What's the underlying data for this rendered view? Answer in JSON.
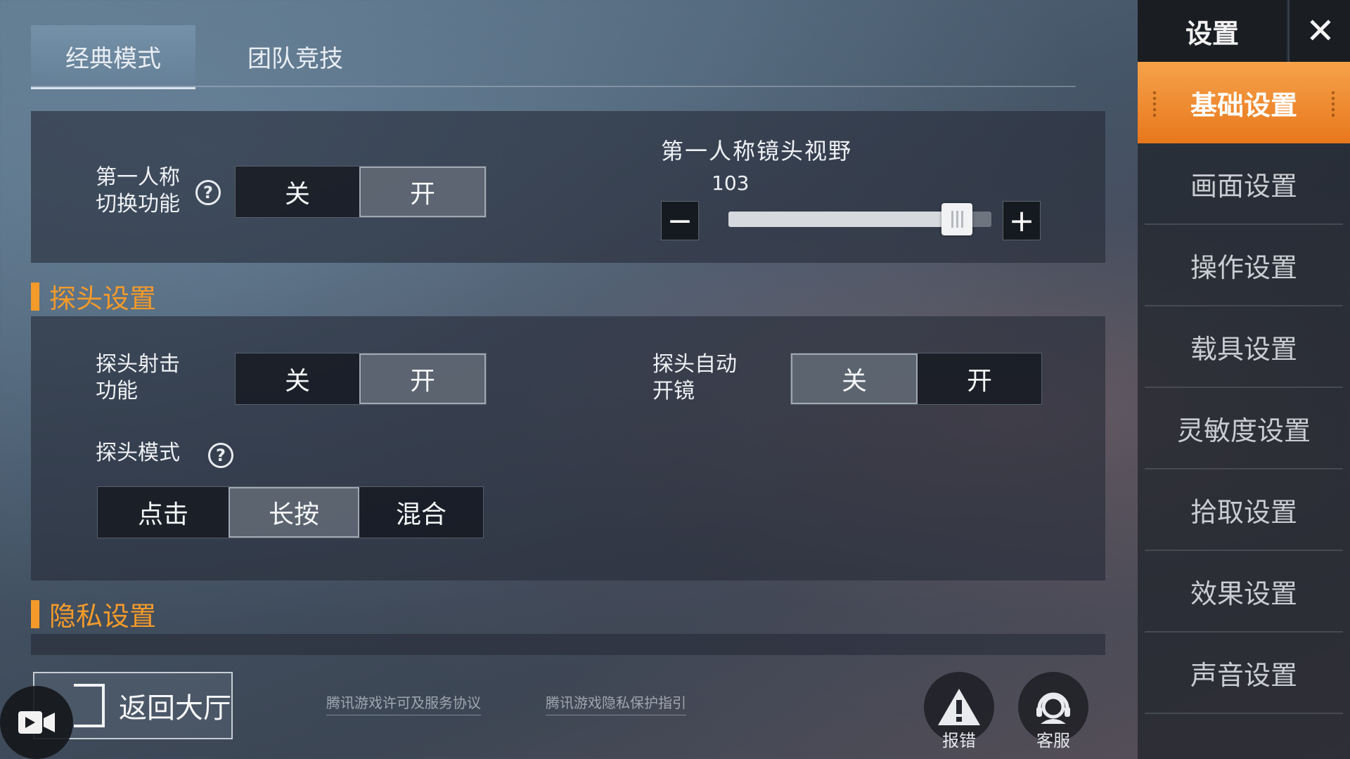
{
  "tabs": [
    {
      "label": "经典模式",
      "active": true
    },
    {
      "label": "团队竞技",
      "active": false
    }
  ],
  "first_person": {
    "label_line1": "第一人称",
    "label_line2": "切换功能",
    "help": "?",
    "options": [
      "关",
      "开"
    ],
    "selected": "开"
  },
  "fov": {
    "label": "第一人称镜头视野",
    "value": "103",
    "minus": "−",
    "plus": "+",
    "slider_fraction": 0.87
  },
  "peek_section": {
    "title": "探头设置",
    "shoot": {
      "label_line1": "探头射击",
      "label_line2": "功能",
      "options": [
        "关",
        "开"
      ],
      "selected": "开"
    },
    "auto_scope": {
      "label_line1": "探头自动",
      "label_line2": "开镜",
      "options": [
        "关",
        "开"
      ],
      "selected": "关"
    },
    "mode": {
      "label": "探头模式",
      "help": "?",
      "options": [
        "点击",
        "长按",
        "混合"
      ],
      "selected": "长按"
    }
  },
  "privacy_section": {
    "title": "隐私设置"
  },
  "sidebar": {
    "title": "设置",
    "close": "✕",
    "items": [
      "基础设置",
      "画面设置",
      "操作设置",
      "载具设置",
      "灵敏度设置",
      "拾取设置",
      "效果设置",
      "声音设置"
    ],
    "active_index": 0
  },
  "bottom": {
    "back_label": "返回大厅",
    "link1": "腾讯游戏许可及服务协议",
    "link2": "腾讯游戏隐私保护指引",
    "report_label": "报错",
    "service_label": "客服"
  },
  "colors": {
    "accent": "#f39a2a",
    "active_tab": "#e8771c"
  },
  "icons": [
    "record-video-icon",
    "back-door-icon",
    "warning-icon",
    "headset-icon",
    "close-icon",
    "help-icon"
  ]
}
